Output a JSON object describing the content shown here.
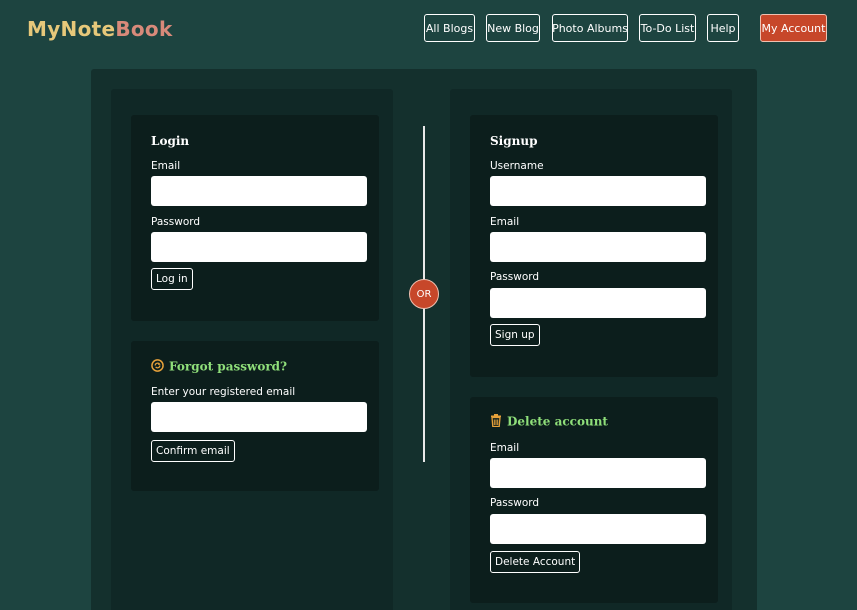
{
  "brand": {
    "name_part1": "MyNote",
    "name_part2": "Book"
  },
  "nav": {
    "items": [
      {
        "label": "All Blogs"
      },
      {
        "label": "New Blog"
      },
      {
        "label": "Photo Albums"
      },
      {
        "label": "To-Do List"
      },
      {
        "label": "Help"
      },
      {
        "label": "My Account"
      }
    ]
  },
  "login": {
    "title": "Login",
    "email_label": "Email",
    "password_label": "Password",
    "button": "Log in"
  },
  "forgot": {
    "title": "Forgot password?",
    "icon": "reset-icon",
    "email_label": "Enter your registered email",
    "button": "Confirm email"
  },
  "divider": {
    "label": "OR"
  },
  "signup": {
    "title": "Signup",
    "username_label": "Username",
    "email_label": "Email",
    "password_label": "Password",
    "button": "Sign up"
  },
  "delete": {
    "title": "Delete account",
    "icon": "trash-icon",
    "email_label": "Email",
    "password_label": "Password",
    "button": "Delete Account"
  },
  "colors": {
    "background": "#1d4440",
    "accent": "#c7472a",
    "section_title_green": "#8fdf7a"
  }
}
